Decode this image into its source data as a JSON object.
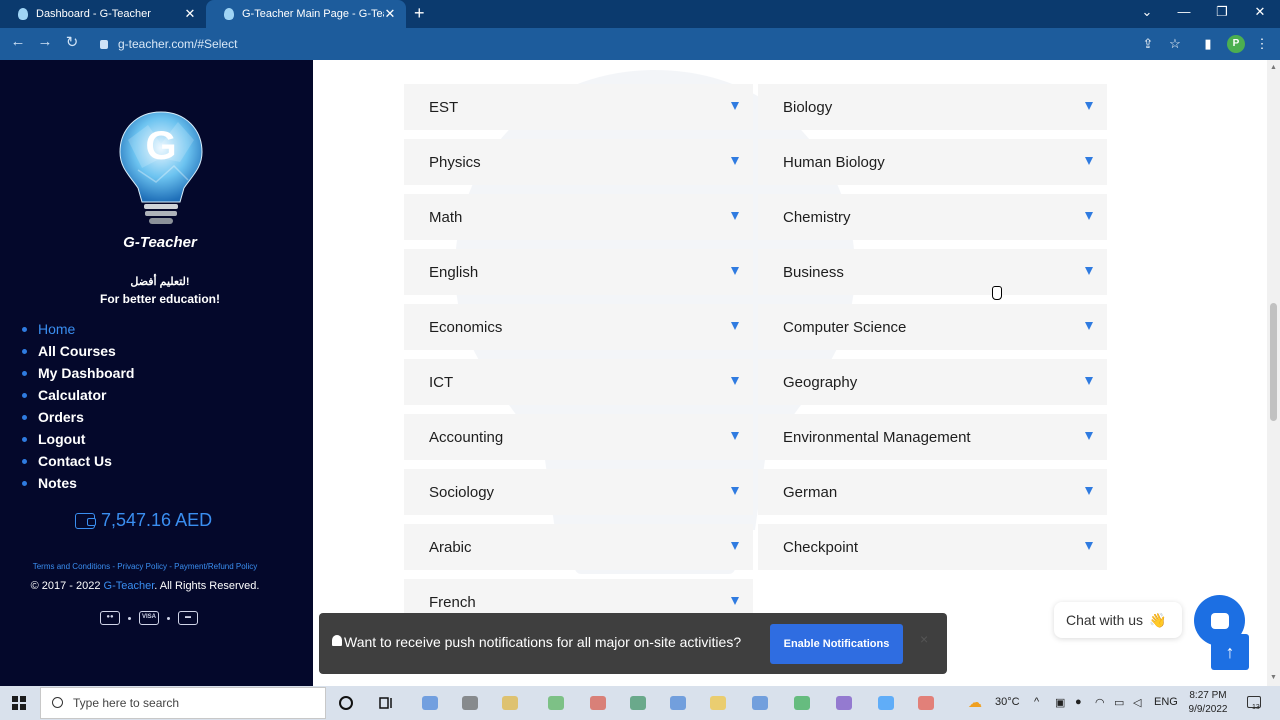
{
  "browser": {
    "tabs": [
      {
        "title": "Dashboard - G-Teacher"
      },
      {
        "title": "G-Teacher Main Page - G-Teacher"
      }
    ],
    "url": "g-teacher.com/#Select",
    "profile_initial": "P"
  },
  "sidebar": {
    "logo_letter": "G",
    "brand": "G-Teacher",
    "tagline_ar": "لتعليم أفضل!",
    "tagline_en": "For better education!",
    "menu": [
      {
        "label": "Home",
        "active": true
      },
      {
        "label": "All Courses"
      },
      {
        "label": "My Dashboard"
      },
      {
        "label": "Calculator"
      },
      {
        "label": "Orders"
      },
      {
        "label": "Logout"
      },
      {
        "label": "Contact Us"
      },
      {
        "label": "Notes"
      }
    ],
    "balance": "7,547.16 AED",
    "footer": {
      "terms": "Terms and Conditions",
      "privacy": "Privacy Policy",
      "refund": "Payment/Refund Policy",
      "copy_prefix": "© 2017 - 2022 ",
      "copy_brand": "G-Teacher",
      "copy_suffix": ". All Rights Reserved."
    },
    "payment_icons": [
      "mastercard-icon",
      "visa-icon",
      "card-icon"
    ]
  },
  "subjects": {
    "left": [
      "EST",
      "Physics",
      "Math",
      "English",
      "Economics",
      "ICT",
      "Accounting",
      "Sociology",
      "Arabic",
      "French"
    ],
    "right": [
      "Biology",
      "Human Biology",
      "Chemistry",
      "Business",
      "Computer Science",
      "Geography",
      "Environmental Management",
      "German",
      "Checkpoint"
    ]
  },
  "notification": {
    "message": "Want to receive push notifications for all major on-site activities?",
    "button": "Enable Notifications",
    "close": "×"
  },
  "chat": {
    "label": "Chat with us",
    "wave": "👋"
  },
  "taskbar": {
    "search_placeholder": "Type here to search",
    "weather": "30°C",
    "language": "ENG",
    "time": "8:27 PM",
    "date": "9/9/2022",
    "notif_count": "13"
  },
  "colors": {
    "sidebar_bg": "#04082b",
    "accent": "#2f7be0",
    "tab_bar": "#0b3a6e",
    "address_bar": "#1d5c9c"
  }
}
